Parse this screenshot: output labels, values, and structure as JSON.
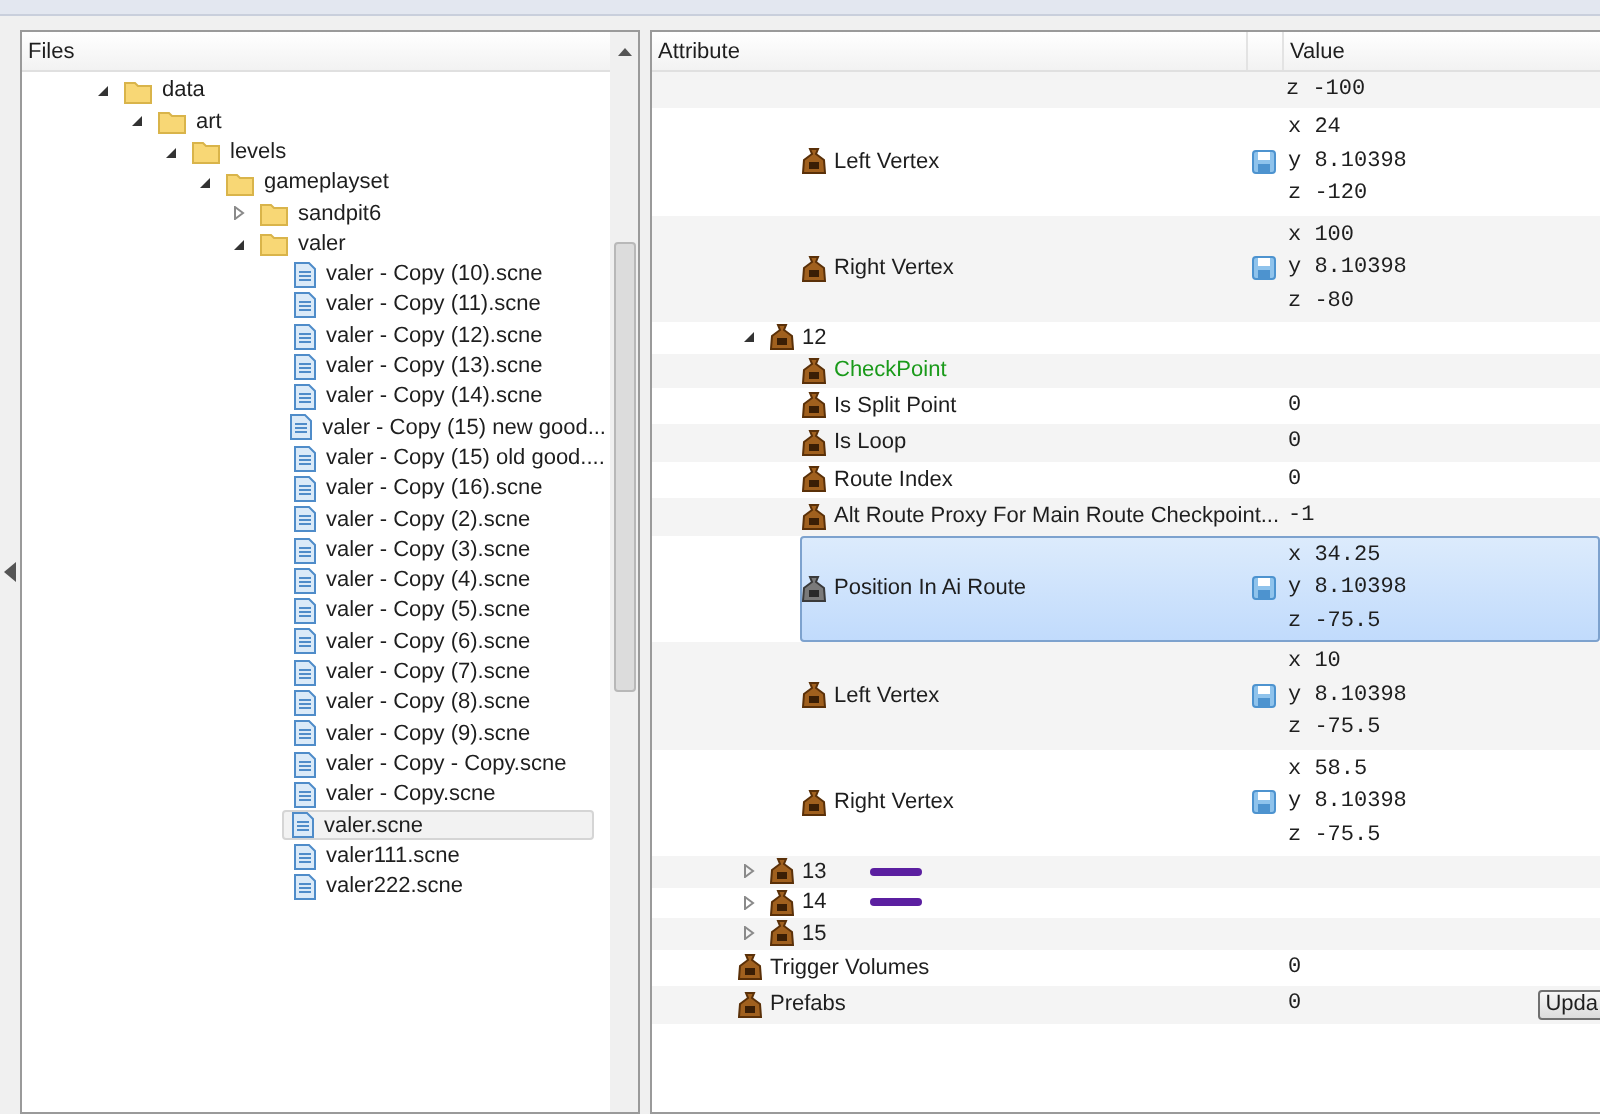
{
  "files_panel": {
    "title": "Files",
    "tree": [
      {
        "name": "data",
        "kind": "folder",
        "expanded": true,
        "selected": false,
        "children": [
          {
            "name": "art",
            "kind": "folder",
            "expanded": true,
            "selected": false,
            "children": [
              {
                "name": "levels",
                "kind": "folder",
                "expanded": true,
                "selected": false,
                "children": [
                  {
                    "name": "gameplayset",
                    "kind": "folder",
                    "expanded": true,
                    "selected": false,
                    "children": [
                      {
                        "name": "sandpit6",
                        "kind": "folder",
                        "expanded": false,
                        "selected": false
                      },
                      {
                        "name": "valer",
                        "kind": "folder",
                        "expanded": true,
                        "selected": false,
                        "children": [
                          {
                            "name": "valer - Copy (10).scne",
                            "kind": "file",
                            "selected": false
                          },
                          {
                            "name": "valer - Copy (11).scne",
                            "kind": "file",
                            "selected": false
                          },
                          {
                            "name": "valer - Copy (12).scne",
                            "kind": "file",
                            "selected": false
                          },
                          {
                            "name": "valer - Copy (13).scne",
                            "kind": "file",
                            "selected": false
                          },
                          {
                            "name": "valer - Copy (14).scne",
                            "kind": "file",
                            "selected": false
                          },
                          {
                            "name": "valer - Copy (15) new good...",
                            "kind": "file",
                            "selected": false
                          },
                          {
                            "name": "valer - Copy (15) old good....",
                            "kind": "file",
                            "selected": false
                          },
                          {
                            "name": "valer - Copy (16).scne",
                            "kind": "file",
                            "selected": false
                          },
                          {
                            "name": "valer - Copy (2).scne",
                            "kind": "file",
                            "selected": false
                          },
                          {
                            "name": "valer - Copy (3).scne",
                            "kind": "file",
                            "selected": false
                          },
                          {
                            "name": "valer - Copy (4).scne",
                            "kind": "file",
                            "selected": false
                          },
                          {
                            "name": "valer - Copy (5).scne",
                            "kind": "file",
                            "selected": false
                          },
                          {
                            "name": "valer - Copy (6).scne",
                            "kind": "file",
                            "selected": false
                          },
                          {
                            "name": "valer - Copy (7).scne",
                            "kind": "file",
                            "selected": false
                          },
                          {
                            "name": "valer - Copy (8).scne",
                            "kind": "file",
                            "selected": false
                          },
                          {
                            "name": "valer - Copy (9).scne",
                            "kind": "file",
                            "selected": false
                          },
                          {
                            "name": "valer - Copy - Copy.scne",
                            "kind": "file",
                            "selected": false
                          },
                          {
                            "name": "valer - Copy.scne",
                            "kind": "file",
                            "selected": false
                          },
                          {
                            "name": "valer.scne",
                            "kind": "file",
                            "selected": true
                          },
                          {
                            "name": "valer111.scne",
                            "kind": "file",
                            "selected": false
                          },
                          {
                            "name": "valer222.scne",
                            "kind": "file",
                            "selected": false
                          }
                        ]
                      }
                    ]
                  }
                ]
              }
            ]
          }
        ]
      }
    ]
  },
  "attributes_panel": {
    "columns": [
      "Attribute",
      "Value"
    ],
    "rows": [
      {
        "kind": "continued",
        "children": [
          {
            "kind": "continued",
            "children": [
              {
                "kind": "tail",
                "lines": [
                  "z -100"
                ]
              },
              {
                "kind": "vector",
                "label": "Left Vertex",
                "selected": false,
                "lines": [
                  "x 24",
                  "y 8.10398",
                  "z -120"
                ]
              },
              {
                "kind": "vector",
                "label": "Right Vertex",
                "selected": false,
                "lines": [
                  "x 100",
                  "y 8.10398",
                  "z -80"
                ]
              }
            ]
          },
          {
            "kind": "group",
            "label": "12",
            "expanded": true,
            "selected": false,
            "annotated": false,
            "children": [
              {
                "kind": "type",
                "label": "CheckPoint",
                "selected": false
              },
              {
                "kind": "field",
                "label": "Is Split Point",
                "value": "0",
                "selected": false
              },
              {
                "kind": "field",
                "label": "Is Loop",
                "value": "0",
                "selected": false
              },
              {
                "kind": "field",
                "label": "Route Index",
                "value": "0",
                "selected": false
              },
              {
                "kind": "field",
                "label": "Alt Route Proxy For Main Route Checkpoint...",
                "value": "-1",
                "selected": false
              },
              {
                "kind": "vector",
                "label": "Position In Ai Route",
                "selected": true,
                "lines": [
                  "x 34.25",
                  "y 8.10398",
                  "z -75.5"
                ]
              },
              {
                "kind": "vector",
                "label": "Left Vertex",
                "selected": false,
                "lines": [
                  "x 10",
                  "y 8.10398",
                  "z -75.5"
                ]
              },
              {
                "kind": "vector",
                "label": "Right Vertex",
                "selected": false,
                "lines": [
                  "x 58.5",
                  "y 8.10398",
                  "z -75.5"
                ]
              }
            ]
          },
          {
            "kind": "group",
            "label": "13",
            "expanded": false,
            "selected": false,
            "annotated": true
          },
          {
            "kind": "group",
            "label": "14",
            "expanded": false,
            "selected": false,
            "annotated": true
          },
          {
            "kind": "group",
            "label": "15",
            "expanded": false,
            "selected": false,
            "annotated": false
          }
        ]
      },
      {
        "kind": "field",
        "label": "Trigger Volumes",
        "value": "0",
        "selected": false
      },
      {
        "kind": "field",
        "label": "Prefabs",
        "value": "0",
        "selected": false,
        "button": "Upda"
      }
    ]
  }
}
